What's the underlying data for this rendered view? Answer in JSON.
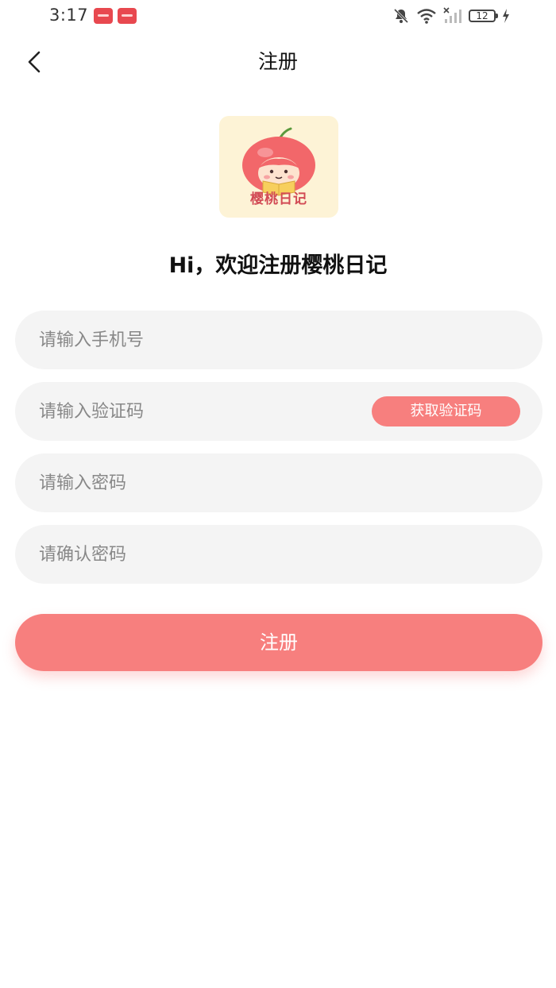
{
  "status_bar": {
    "time": "3:17",
    "battery_level": "12",
    "icons": [
      "muted-bell-icon",
      "wifi-icon",
      "signal-icon",
      "battery-icon",
      "charging-icon"
    ]
  },
  "nav": {
    "title": "注册",
    "back_icon": "chevron-left-icon"
  },
  "logo": {
    "text": "樱桃日记",
    "icon": "cherry-girl-logo"
  },
  "welcome": "Hi，欢迎注册樱桃日记",
  "form": {
    "phone_placeholder": "请输入手机号",
    "code_placeholder": "请输入验证码",
    "get_code_label": "获取验证码",
    "password_placeholder": "请输入密码",
    "confirm_placeholder": "请确认密码",
    "submit_label": "注册"
  },
  "colors": {
    "accent": "#f77f7e",
    "field_bg": "#f4f4f4",
    "logo_bg": "#fdf3d6"
  }
}
